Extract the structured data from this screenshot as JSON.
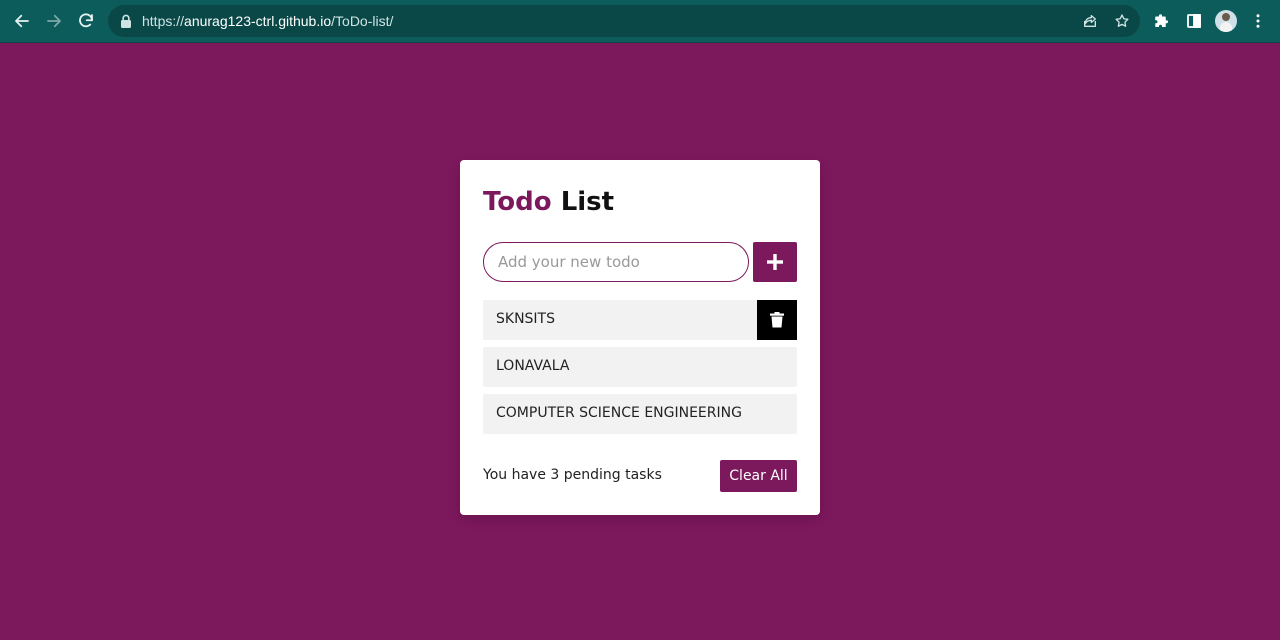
{
  "browser": {
    "url_prefix": "https://",
    "url_host": "anurag123-ctrl.github.io",
    "url_path": "/ToDo-list/"
  },
  "colors": {
    "page_background": "#7c185c",
    "accent": "#7c185c",
    "chrome": "#0d5c5c"
  },
  "icons": {
    "back": "arrow-left-icon",
    "forward": "arrow-right-icon",
    "reload": "reload-icon",
    "lock": "lock-icon",
    "share": "share-icon",
    "bookmark": "star-icon",
    "extensions": "puzzle-icon",
    "side_panel": "side-panel-icon",
    "menu": "kebab-menu-icon",
    "add": "plus-icon",
    "delete": "trash-icon"
  },
  "app": {
    "title_accent": "Todo",
    "title_rest": "List",
    "input_placeholder": "Add your new todo",
    "input_value": "",
    "todos": [
      {
        "text": "SKNSITS"
      },
      {
        "text": "LONAVALA"
      },
      {
        "text": "COMPUTER SCIENCE ENGINEERING"
      }
    ],
    "pending_text": "You have 3 pending tasks",
    "clear_label": "Clear All"
  }
}
